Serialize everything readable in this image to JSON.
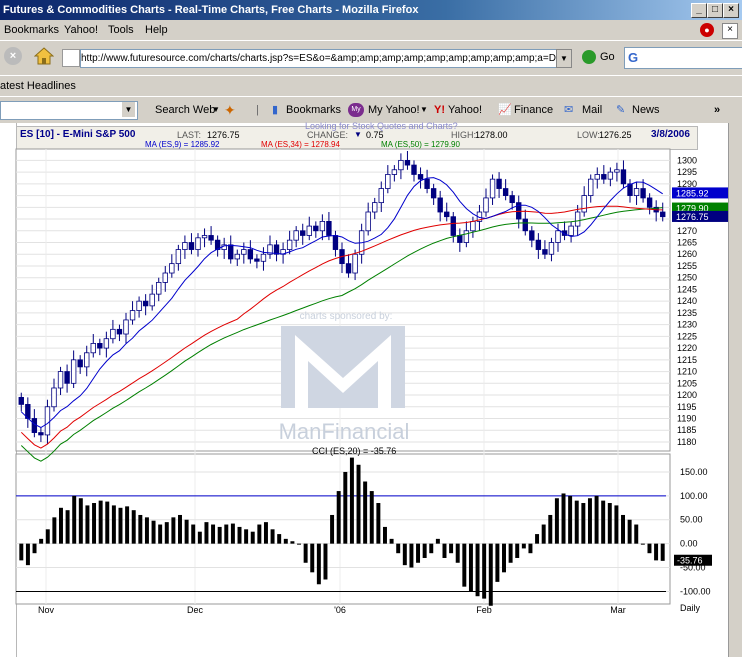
{
  "window": {
    "title": "Futures & Commodities Charts - Real-Time Charts, Free Charts - Mozilla Firefox"
  },
  "menu": {
    "bookmarks": "Bookmarks",
    "yahoo": "Yahoo!",
    "tools": "Tools",
    "help": "Help"
  },
  "nav": {
    "url": "http://www.futuresource.com/charts/charts.jsp?s=ES&o=&amp;amp;amp;amp;amp;amp;amp;amp;amp;a=D0",
    "go": "Go"
  },
  "bookmarks_bar": {
    "item": "atest Headlines"
  },
  "yahoo_toolbar": {
    "search_web": "Search Web",
    "bookmarks": "Bookmarks",
    "my_yahoo": "My Yahoo!",
    "yahoo": "Yahoo!",
    "finance": "Finance",
    "mail": "Mail",
    "news": "News"
  },
  "chart_header": {
    "symbol": "ES [10] - E-Mini S&P 500",
    "last_label": "LAST:",
    "last": "1276.75",
    "change_label": "CHANGE:",
    "change": "0.75",
    "high_label": "HIGH:",
    "high": "1278.00",
    "low_label": "LOW:",
    "low": "1276.25",
    "date": "3/8/2006",
    "ma9": "MA (ES,9) = 1285.92",
    "ma34": "MA (ES,34) = 1278.94",
    "ma50": "MA (ES,50) = 1279.90",
    "behind_text": "Looking for Stock Quotes and Charts?",
    "cci_label": "CCI (ES,20) = -35.76",
    "watermark_top": "charts sponsored by:",
    "watermark_brand": "ManFinancial",
    "period": "Daily"
  },
  "colors": {
    "ma9": "#0000cc",
    "ma34": "#e00000",
    "ma50": "#008000",
    "candle": "#000080"
  },
  "chart_data": [
    {
      "type": "candlestick",
      "title": "ES [10] - E-Mini S&P 500",
      "ylim": [
        1177,
        1304
      ],
      "yticks": [
        1180,
        1185,
        1190,
        1195,
        1200,
        1205,
        1210,
        1215,
        1220,
        1225,
        1230,
        1235,
        1240,
        1245,
        1250,
        1255,
        1260,
        1265,
        1270,
        1275,
        1280,
        1285,
        1290,
        1295,
        1300
      ],
      "xticks": [
        "Nov",
        "Dec",
        "'06",
        "Feb",
        "Mar"
      ],
      "price_tags": [
        "1285.92",
        "1279.90",
        "1276.75"
      ],
      "series": [
        {
          "name": "MA (ES,9)",
          "value": 1285.92
        },
        {
          "name": "MA (ES,34)",
          "value": 1278.94
        },
        {
          "name": "MA (ES,50)",
          "value": 1279.9
        }
      ],
      "close_values": [
        1196,
        1190,
        1184,
        1183,
        1195,
        1203,
        1210,
        1205,
        1215,
        1212,
        1218,
        1222,
        1220,
        1224,
        1228,
        1226,
        1232,
        1236,
        1240,
        1238,
        1243,
        1248,
        1252,
        1256,
        1262,
        1265,
        1262,
        1267,
        1268,
        1266,
        1262,
        1264,
        1258,
        1260,
        1262,
        1258,
        1257,
        1260,
        1264,
        1260,
        1262,
        1266,
        1270,
        1268,
        1272,
        1270,
        1274,
        1268,
        1262,
        1256,
        1252,
        1260,
        1270,
        1278,
        1282,
        1288,
        1294,
        1296,
        1300,
        1298,
        1294,
        1292,
        1288,
        1284,
        1278,
        1276,
        1268,
        1265,
        1270,
        1274,
        1278,
        1284,
        1292,
        1288,
        1285,
        1282,
        1275,
        1270,
        1266,
        1262,
        1260,
        1265,
        1270,
        1268,
        1272,
        1278,
        1285,
        1292,
        1294,
        1292,
        1295,
        1296,
        1290,
        1285,
        1288,
        1284,
        1280,
        1278,
        1276
      ]
    },
    {
      "type": "bar",
      "title": "CCI (ES,20) = -35.76",
      "ylim": [
        -120,
        175
      ],
      "yticks": [
        150,
        100,
        50,
        0,
        -50,
        -100
      ],
      "reference_lines": [
        100,
        -100
      ],
      "last_value": -35.76,
      "values": [
        -35,
        -45,
        -20,
        10,
        30,
        55,
        75,
        70,
        100,
        95,
        80,
        85,
        90,
        88,
        80,
        75,
        78,
        70,
        60,
        55,
        48,
        40,
        45,
        55,
        60,
        50,
        40,
        25,
        45,
        40,
        35,
        40,
        42,
        35,
        30,
        25,
        40,
        45,
        30,
        20,
        10,
        5,
        0,
        -40,
        -60,
        -85,
        -75,
        60,
        110,
        150,
        180,
        165,
        130,
        110,
        85,
        35,
        10,
        -20,
        -45,
        -50,
        -40,
        -30,
        -20,
        10,
        -30,
        -20,
        -40,
        -90,
        -100,
        -110,
        -115,
        -130,
        -80,
        -60,
        -40,
        -30,
        -10,
        -20,
        20,
        40,
        60,
        95,
        105,
        100,
        90,
        85,
        95,
        100,
        90,
        85,
        80,
        60,
        50,
        40,
        0,
        -20,
        -35,
        -36
      ]
    }
  ]
}
